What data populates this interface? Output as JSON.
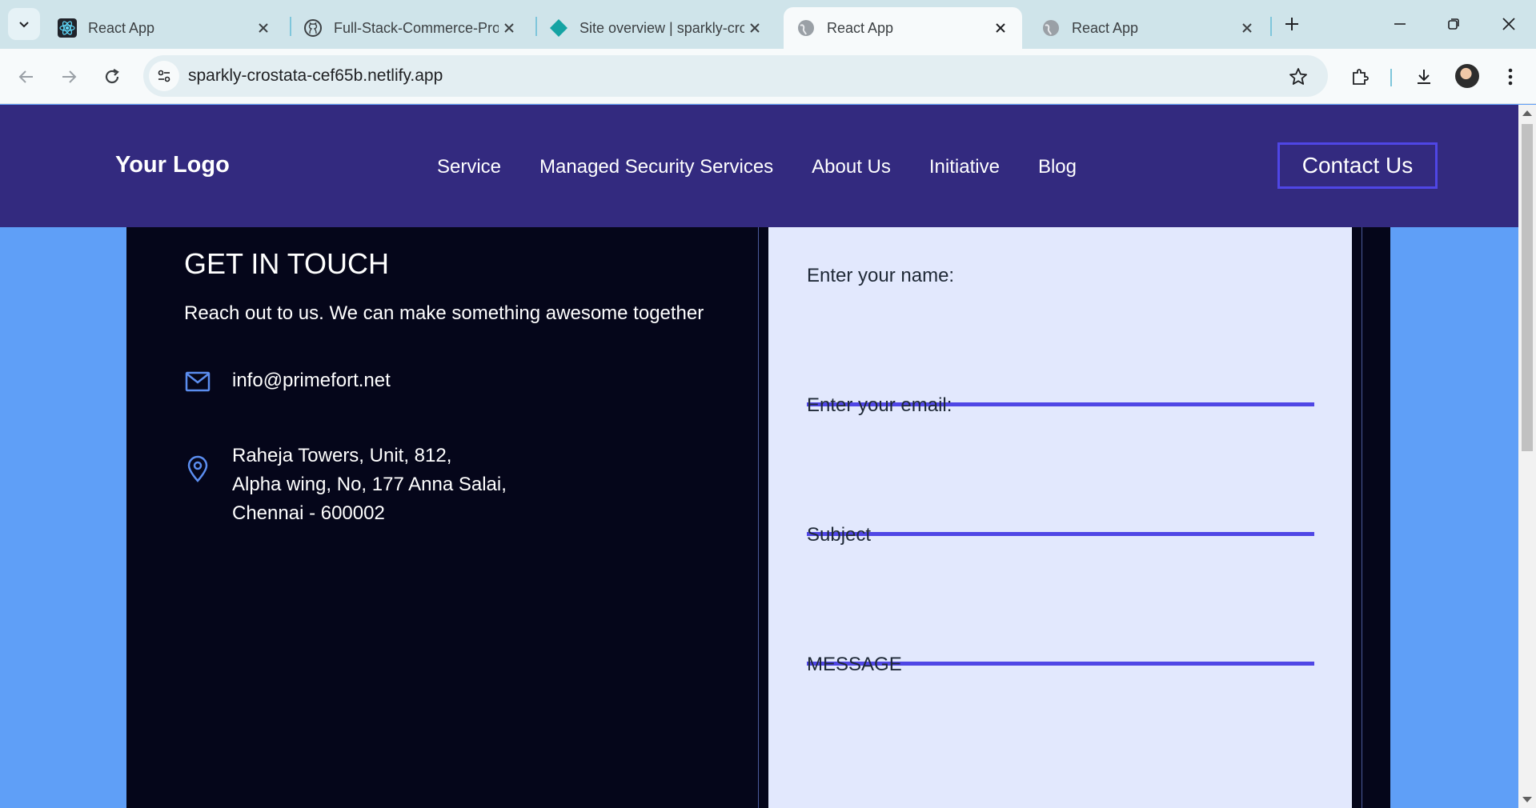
{
  "browser": {
    "tabs": [
      {
        "title": "React App",
        "icon": "react-icon",
        "active": false
      },
      {
        "title": "Full-Stack-Commerce-Project",
        "icon": "github-icon",
        "active": false
      },
      {
        "title": "Site overview | sparkly-crostata",
        "icon": "netlify-icon",
        "active": false
      },
      {
        "title": "React App",
        "icon": "globe-icon",
        "active": true
      },
      {
        "title": "React App",
        "icon": "globe-icon",
        "active": false
      }
    ],
    "url": "sparkly-crostata-cef65b.netlify.app"
  },
  "page": {
    "navbar": {
      "logo": "Your Logo",
      "links": [
        "Service",
        "Managed Security Services",
        "About Us",
        "Initiative",
        "Blog"
      ],
      "cta": "Contact Us",
      "bg_color": "#332a7f"
    },
    "contact": {
      "title": "GET IN TOUCH",
      "subtitle": "Reach out to us. We can make something awesome together",
      "email": "info@primefort.net",
      "address_lines": [
        "Raheja Towers, Unit, 812,",
        "Alpha wing, No, 177 Anna Salai,",
        "Chennai - 600002"
      ]
    },
    "form": {
      "name_label": "Enter your name:",
      "email_label": "Enter your email:",
      "subject_label": "Subject",
      "message_label": "MESSAGE",
      "accent_color": "#4f46e5"
    }
  }
}
